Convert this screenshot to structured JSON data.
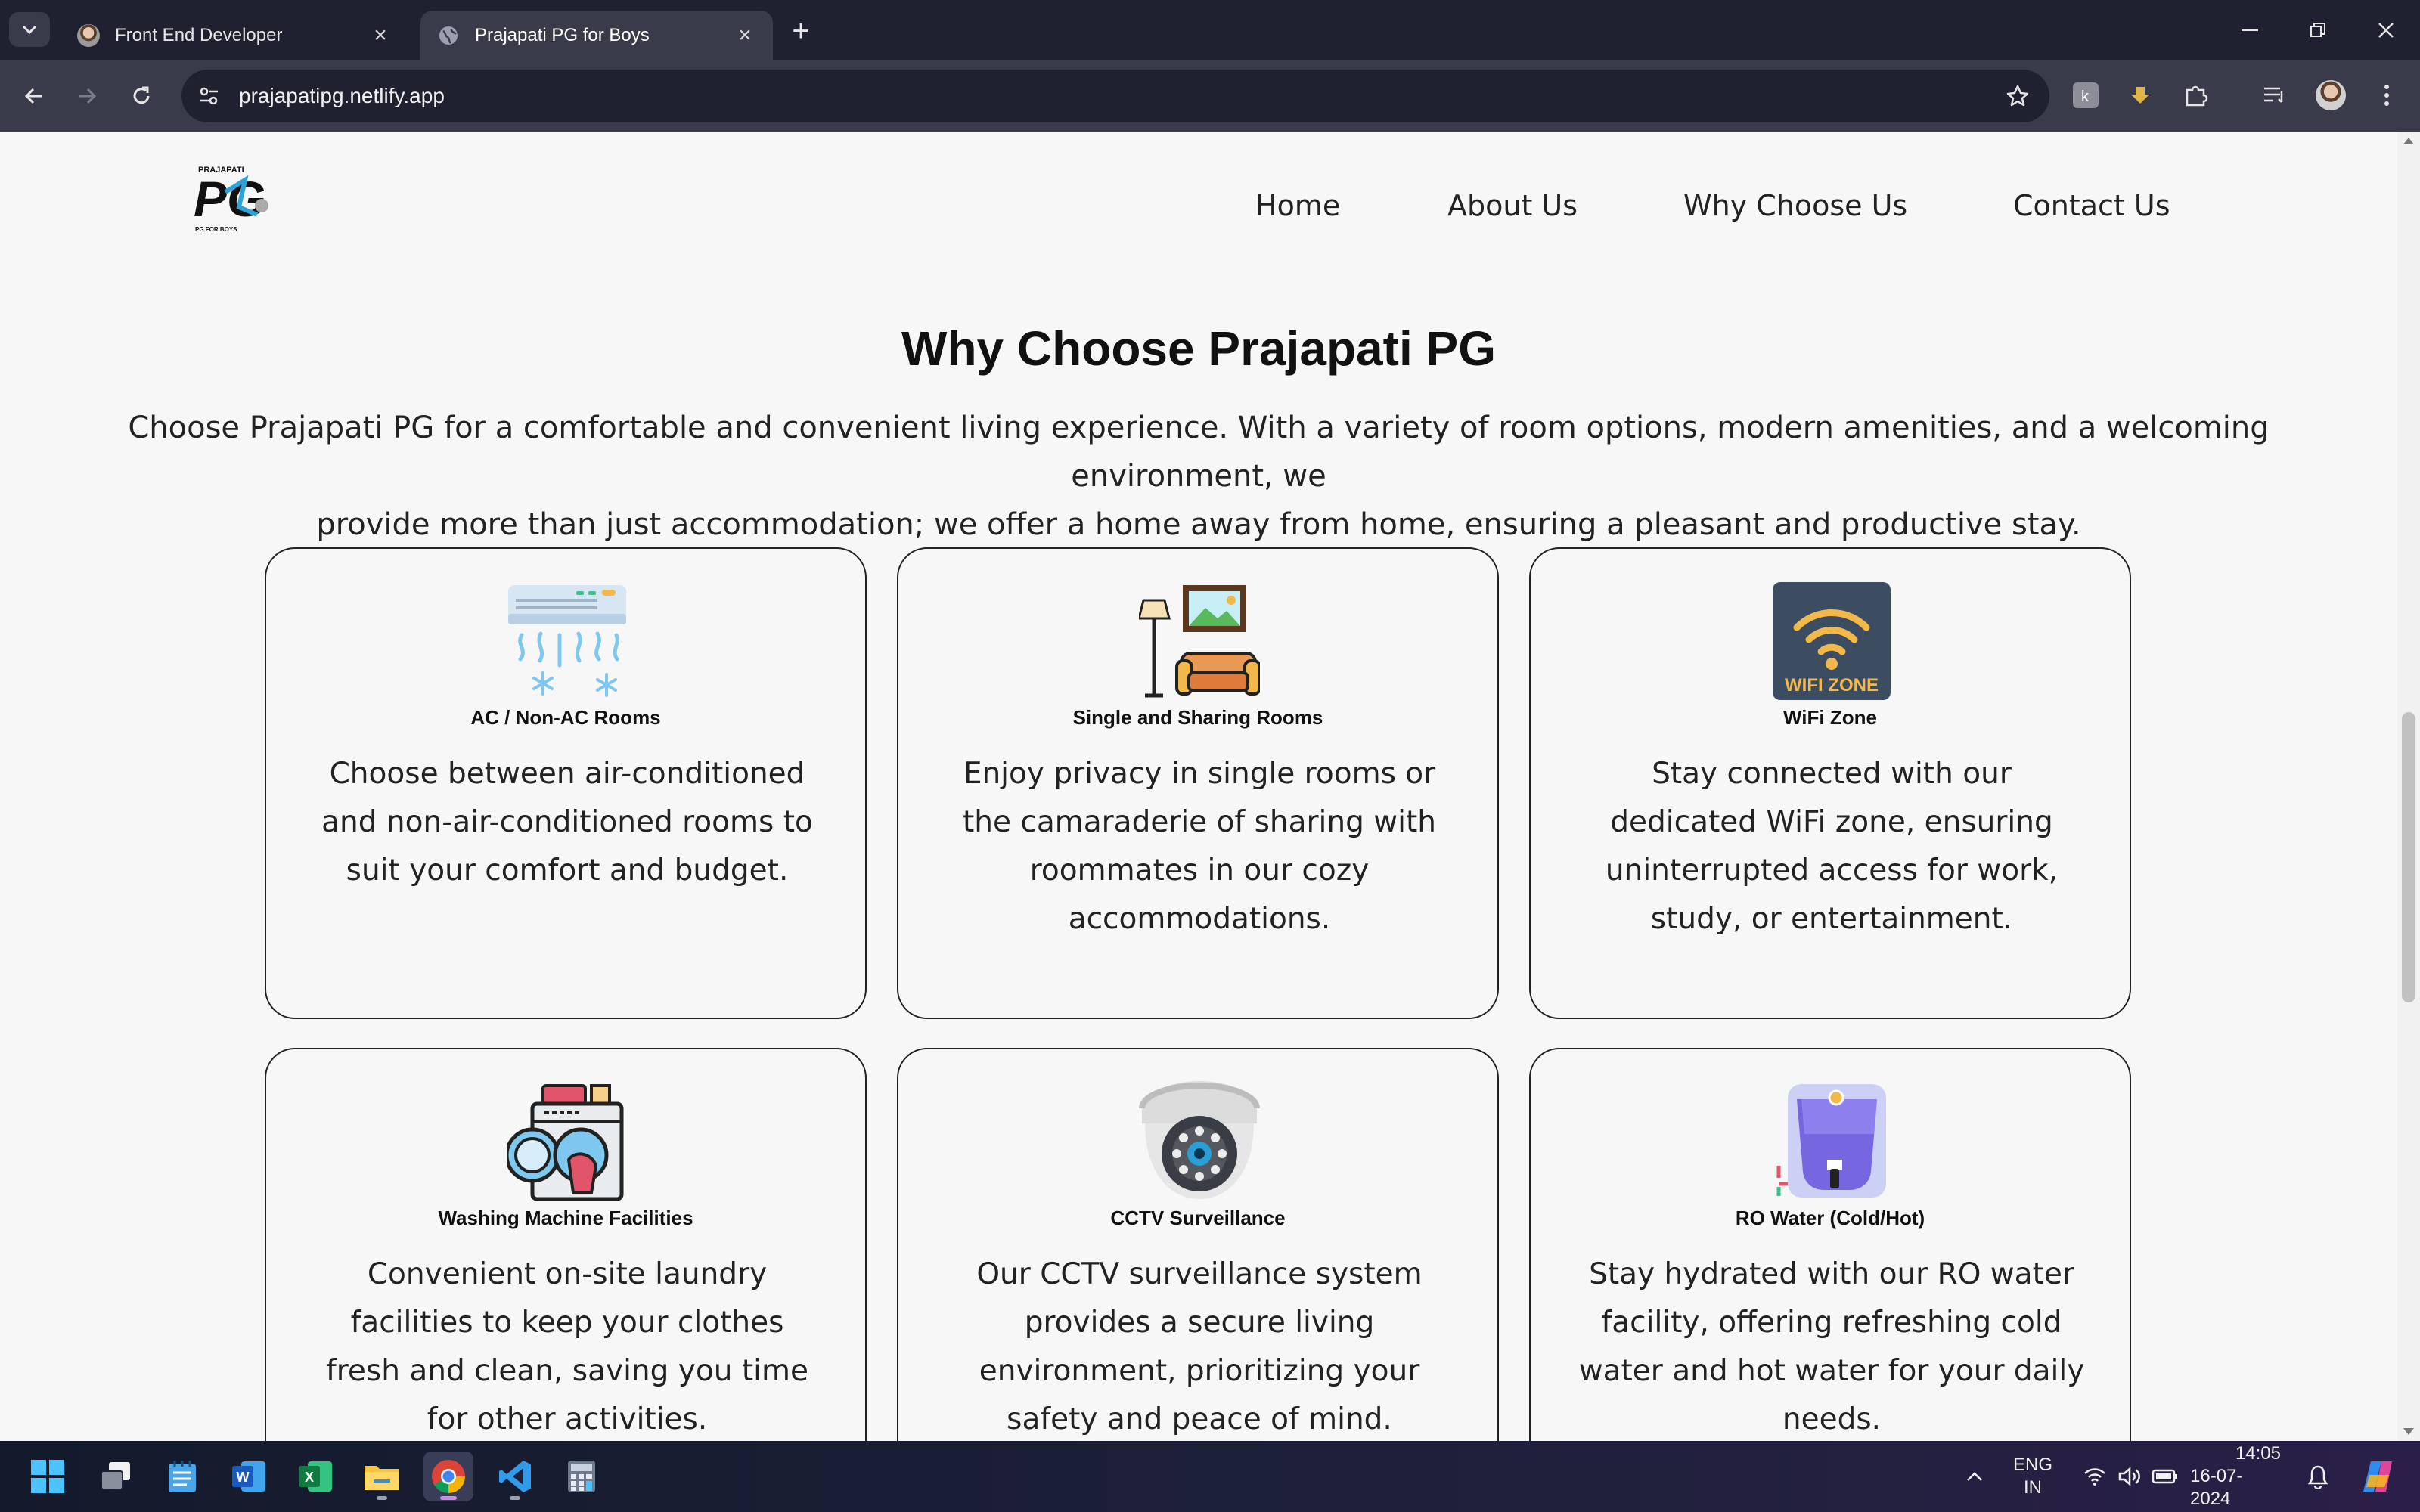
{
  "browser": {
    "tabs": [
      {
        "title": "Front End Developer",
        "active": false
      },
      {
        "title": "Prajapati PG for Boys",
        "active": true
      }
    ],
    "url": "prajapatipg.netlify.app"
  },
  "site": {
    "logo": {
      "brand": "PRAJAPATI",
      "mark": "PG",
      "tagline": "PG FOR BOYS"
    },
    "nav": [
      "Home",
      "About Us",
      "Why Choose Us",
      "Contact Us"
    ]
  },
  "why_section": {
    "title": "Why Choose Prajapati PG",
    "intro_line1": "Choose Prajapati PG for a comfortable and convenient living experience. With a variety of room options, modern amenities, and a welcoming environment, we",
    "intro_line2": "provide more than just accommodation; we offer a home away from home, ensuring a pleasant and productive stay.",
    "cards": [
      {
        "title": "AC / Non-AC Rooms",
        "icon": "air-conditioner-icon",
        "desc": "Choose between air-conditioned and non-air-conditioned rooms to suit your comfort and budget."
      },
      {
        "title": "Single and Sharing Rooms",
        "icon": "sofa-room-icon",
        "desc": "Enjoy privacy in single rooms or the camaraderie of sharing with roommates in our cozy accommodations."
      },
      {
        "title": "WiFi Zone",
        "icon": "wifi-zone-icon",
        "icon_text": "WIFI ZONE",
        "desc": "Stay connected with our dedicated WiFi zone, ensuring uninterrupted access for work, study, or entertainment."
      },
      {
        "title": "Washing Machine Facilities",
        "icon": "washing-machine-icon",
        "desc": "Convenient on-site laundry facilities to keep your clothes fresh and clean, saving you time for other activities."
      },
      {
        "title": "CCTV Surveillance",
        "icon": "cctv-camera-icon",
        "desc": "Our CCTV surveillance system provides a secure living environment, prioritizing your safety and peace of mind."
      },
      {
        "title": "RO Water (Cold/Hot)",
        "icon": "water-purifier-icon",
        "desc": "Stay hydrated with our RO water facility, offering refreshing cold water and hot water for your daily needs."
      }
    ]
  },
  "taskbar": {
    "apps": [
      "start-icon",
      "task-view-icon",
      "notepad-icon",
      "word-icon",
      "excel-icon",
      "file-explorer-icon",
      "chrome-icon",
      "vscode-icon",
      "calculator-icon"
    ],
    "language_line1": "ENG",
    "language_line2": "IN",
    "time": "14:05",
    "date": "16-07-2024"
  }
}
